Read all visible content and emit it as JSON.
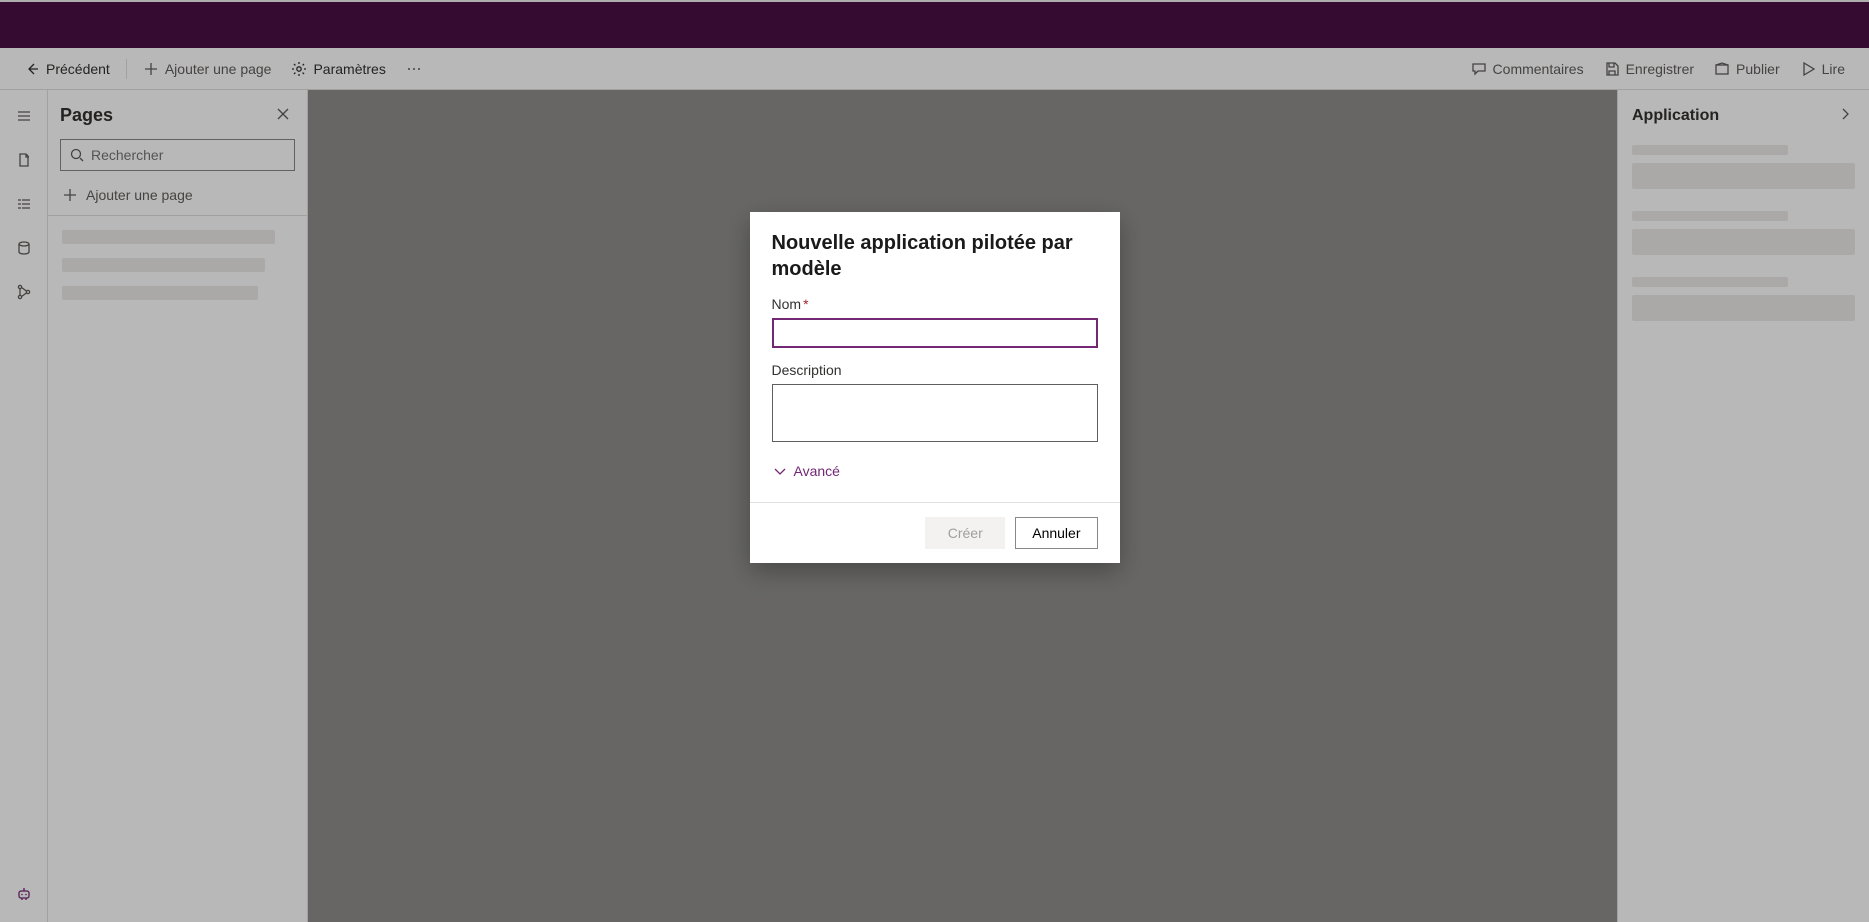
{
  "commandbar": {
    "back": "Précédent",
    "addPage": "Ajouter une page",
    "settings": "Paramètres",
    "comments": "Commentaires",
    "save": "Enregistrer",
    "publish": "Publier",
    "play": "Lire"
  },
  "pagesPanel": {
    "title": "Pages",
    "searchPlaceholder": "Rechercher",
    "addPage": "Ajouter une page"
  },
  "appPanel": {
    "title": "Application"
  },
  "modal": {
    "title": "Nouvelle application pilotée par modèle",
    "nameLabel": "Nom",
    "descLabel": "Description",
    "advanced": "Avancé",
    "create": "Créer",
    "cancel": "Annuler"
  },
  "colors": {
    "brand": "#742774",
    "titlebar": "#4b1046"
  }
}
